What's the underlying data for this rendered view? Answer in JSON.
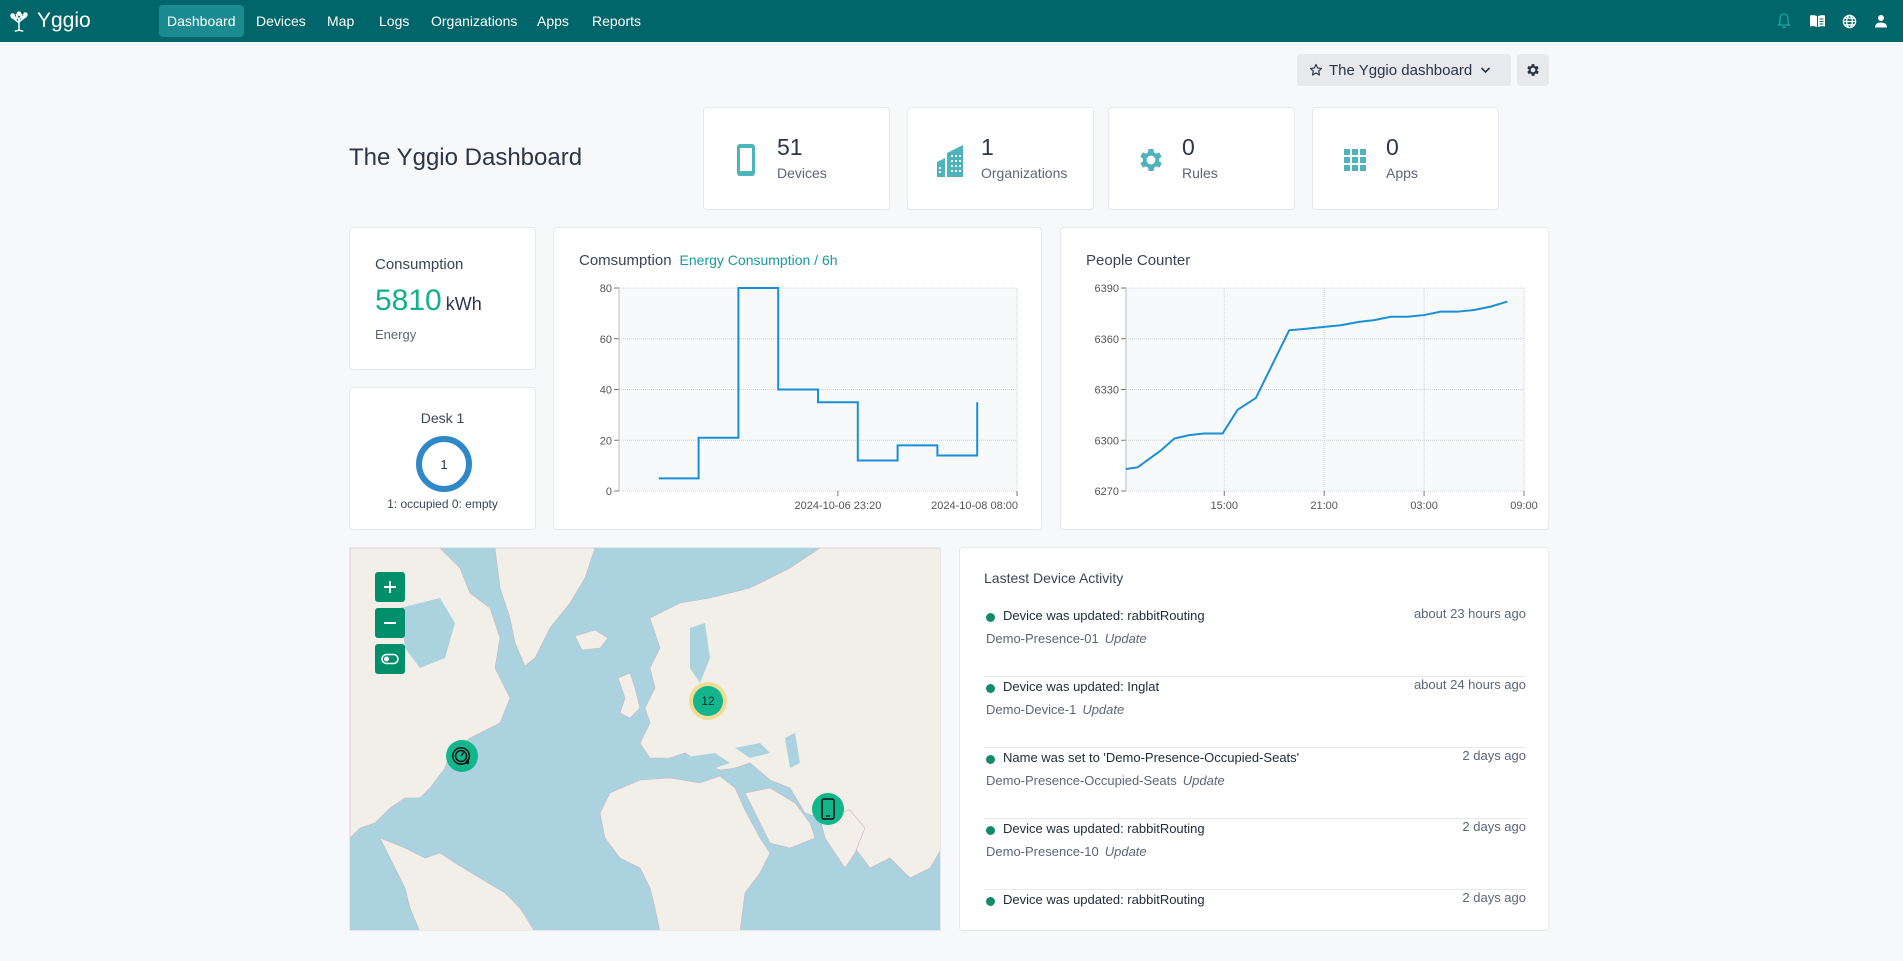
{
  "app": {
    "brand": "Yggio",
    "nav": [
      {
        "label": "Dashboard",
        "active": true
      },
      {
        "label": "Devices"
      },
      {
        "label": "Map"
      },
      {
        "label": "Logs"
      },
      {
        "label": "Organizations"
      },
      {
        "label": "Apps"
      },
      {
        "label": "Reports"
      }
    ],
    "nav_icons": [
      "bell-icon",
      "book-icon",
      "globe-icon",
      "user-icon"
    ]
  },
  "toolbar": {
    "dashboard_select": "The Yggio dashboard"
  },
  "page": {
    "title": "The Yggio Dashboard"
  },
  "stats": [
    {
      "value": "51",
      "label": "Devices",
      "icon": "phone-icon"
    },
    {
      "value": "1",
      "label": "Organizations",
      "icon": "building-icon"
    },
    {
      "value": "0",
      "label": "Rules",
      "icon": "gear-icon"
    },
    {
      "value": "0",
      "label": "Apps",
      "icon": "grid-icon"
    }
  ],
  "consumption": {
    "title": "Consumption",
    "value": "5810",
    "unit": "kWh",
    "subtitle": "Energy"
  },
  "desk": {
    "title": "Desk 1",
    "value": "1",
    "legend": "1: occupied 0: empty"
  },
  "colors": {
    "brand": "#00666b",
    "accent": "#13b08a",
    "line": "#1a8fd6",
    "marker": "#13b58d"
  },
  "chart_data": [
    {
      "type": "line",
      "step": true,
      "title": "Comsumption",
      "subtitle": "Energy Consumption / 6h",
      "xlabel": "",
      "ylabel": "",
      "ylim": [
        0,
        80
      ],
      "yticks": [
        0,
        20,
        40,
        60,
        80
      ],
      "xtick_labels": [
        "2024-10-06 23:20",
        "2024-10-08 08:00"
      ],
      "x_domain_index": [
        -2,
        8
      ],
      "xtick_index": [
        3.5,
        8
      ],
      "series": [
        {
          "name": "Energy Consumption / 6h",
          "values": [
            5,
            21,
            80,
            40,
            35,
            12,
            18,
            14,
            35
          ]
        }
      ],
      "grid": true
    },
    {
      "type": "line",
      "title": "People Counter",
      "xlabel": "",
      "ylabel": "",
      "ylim": [
        6270,
        6390
      ],
      "yticks": [
        6270,
        6300,
        6330,
        6360,
        6390
      ],
      "xtick_labels": [
        "15:00",
        "21:00",
        "03:00",
        "09:00"
      ],
      "x_hours": [
        15,
        21,
        27,
        33
      ],
      "x_range_hours": [
        9.1,
        33.0
      ],
      "series": [
        {
          "name": "People Counter",
          "x_hours": [
            9.1,
            9.8,
            10.5,
            11.2,
            12.0,
            12.9,
            13.8,
            14.9,
            15.8,
            16.9,
            18.9,
            20.0,
            21.0,
            22.0,
            23.1,
            24.0,
            25.0,
            26.0,
            27.0,
            28.0,
            29.0,
            30.0,
            31.0,
            32.0
          ],
          "values": [
            6283,
            6284,
            6289,
            6294,
            6301,
            6303,
            6304,
            6304,
            6318,
            6325,
            6365,
            6366,
            6367,
            6368,
            6370,
            6371,
            6373,
            6373,
            6374,
            6376,
            6376,
            6377,
            6379,
            6382
          ]
        }
      ],
      "grid": true
    }
  ],
  "map": {
    "controls": [
      "zoom-in",
      "zoom-out",
      "toggle-layer"
    ],
    "cluster_count": "12"
  },
  "activity": {
    "title": "Lastest Device Activity",
    "items": [
      {
        "message": "Device was updated: rabbitRouting",
        "device": "Demo-Presence-01",
        "type": "Update",
        "time": "about 23 hours ago"
      },
      {
        "message": "Device was updated: Inglat",
        "device": "Demo-Device-1",
        "type": "Update",
        "time": "about 24 hours ago"
      },
      {
        "message": "Name was set to 'Demo-Presence-Occupied-Seats'",
        "device": "Demo-Presence-Occupied-Seats",
        "type": "Update",
        "time": "2 days ago"
      },
      {
        "message": "Device was updated: rabbitRouting",
        "device": "Demo-Presence-10",
        "type": "Update",
        "time": "2 days ago"
      },
      {
        "message": "Device was updated: rabbitRouting",
        "device": "",
        "type": "",
        "time": "2 days ago"
      }
    ]
  }
}
